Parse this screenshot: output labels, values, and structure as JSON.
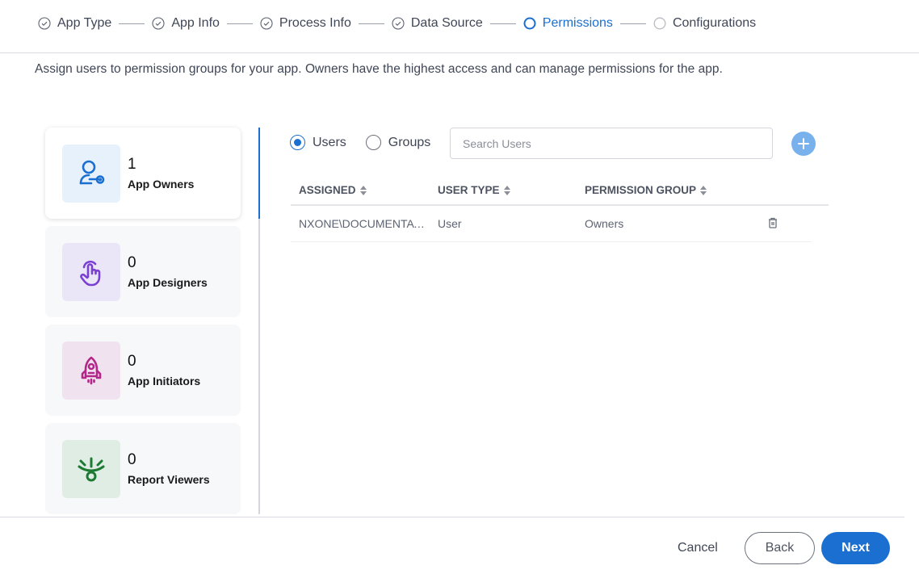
{
  "stepper": {
    "steps": [
      {
        "label": "App Type",
        "state": "completed",
        "icon": "check-circle-icon"
      },
      {
        "label": "App Info",
        "state": "completed",
        "icon": "check-circle-icon"
      },
      {
        "label": "Process Info",
        "state": "completed",
        "icon": "check-circle-icon"
      },
      {
        "label": "Data Source",
        "state": "completed",
        "icon": "check-circle-icon"
      },
      {
        "label": "Permissions",
        "state": "active",
        "icon": "ring-icon"
      },
      {
        "label": "Configurations",
        "state": "pending",
        "icon": "empty-circle-icon"
      }
    ]
  },
  "intro_text": "Assign users to permission groups for your app. Owners have the highest access and can manage permissions for the app.",
  "permission_groups": [
    {
      "count": "1",
      "label": "App Owners",
      "icon": "user-key-icon",
      "color": "#1a6fd0",
      "bg": "#e6f1fc",
      "selected": true
    },
    {
      "count": "0",
      "label": "App Designers",
      "icon": "hand-pointer-icon",
      "color": "#7a3fd3",
      "bg": "#ebe6f7",
      "selected": false
    },
    {
      "count": "0",
      "label": "App Initiators",
      "icon": "rocket-icon",
      "color": "#b3268a",
      "bg": "#f0e2ee",
      "selected": false
    },
    {
      "count": "0",
      "label": "Report Viewers",
      "icon": "eye-lashes-icon",
      "color": "#1d7a33",
      "bg": "#e0ede4",
      "selected": false
    }
  ],
  "assign": {
    "radio_options": [
      {
        "label": "Users",
        "checked": true
      },
      {
        "label": "Groups",
        "checked": false
      }
    ],
    "search_placeholder": "Search Users",
    "search_value": "",
    "add_icon": "plus-icon"
  },
  "table": {
    "columns": [
      "ASSIGNED",
      "USER TYPE",
      "PERMISSION GROUP"
    ],
    "rows": [
      {
        "assigned": "NXONE\\DOCUMENTATI...",
        "user_type": "User",
        "permission_group": "Owners",
        "action_icon": "trash-icon"
      }
    ]
  },
  "footer": {
    "cancel_label": "Cancel",
    "back_label": "Back",
    "next_label": "Next"
  },
  "colors": {
    "accent": "#1a6fd0",
    "add_button": "#78b1ec"
  }
}
